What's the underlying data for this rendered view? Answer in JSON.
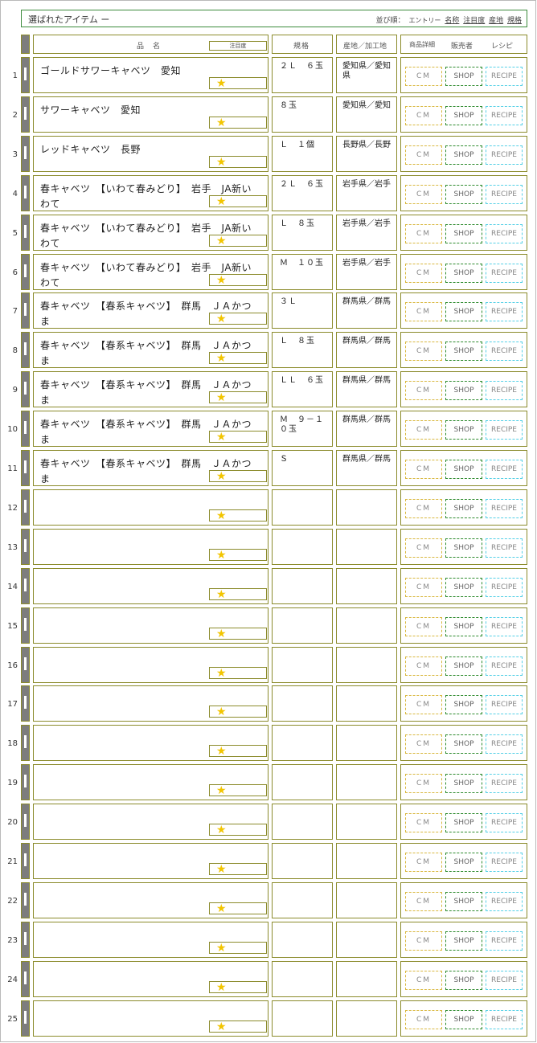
{
  "header": {
    "title": "選ばれたアイテム ー",
    "sort_label": "並び順：",
    "sort_options": [
      "エントリー",
      "名称",
      "注目度",
      "産地",
      "規格"
    ]
  },
  "columns": {
    "name": "品　名",
    "attention": "注目度",
    "spec": "規格",
    "origin": "産地／加工地",
    "detail": "商品詳細",
    "seller": "販売者",
    "recipe": "レシピ"
  },
  "buttons": {
    "cm": "CM",
    "shop": "SHOP",
    "recipe": "RECIPE"
  },
  "star": "★",
  "rows": [
    {
      "num": "1",
      "name": "ゴールドサワーキャベツ　愛知",
      "spec": "２Ｌ　６玉",
      "origin": "愛知県／愛知県"
    },
    {
      "num": "2",
      "name": "サワーキャベツ　愛知",
      "spec": "８玉",
      "origin": "愛知県／愛知"
    },
    {
      "num": "3",
      "name": "レッドキャベツ　長野",
      "spec": "Ｌ　１個",
      "origin": "長野県／長野"
    },
    {
      "num": "4",
      "name": "春キャベツ　【いわて春みどり】　岩手　JA新いわて",
      "spec": "２Ｌ　６玉",
      "origin": "岩手県／岩手"
    },
    {
      "num": "5",
      "name": "春キャベツ　【いわて春みどり】　岩手　JA新いわて",
      "spec": "Ｌ　８玉",
      "origin": "岩手県／岩手"
    },
    {
      "num": "6",
      "name": "春キャベツ　【いわて春みどり】　岩手　JA新いわて",
      "spec": "Ｍ　１０玉",
      "origin": "岩手県／岩手"
    },
    {
      "num": "7",
      "name": "春キャベツ　【春系キャベツ】　群馬　ＪＡかつま",
      "spec": "３Ｌ",
      "origin": "群馬県／群馬"
    },
    {
      "num": "8",
      "name": "春キャベツ　【春系キャベツ】　群馬　ＪＡかつま",
      "spec": "Ｌ　８玉",
      "origin": "群馬県／群馬"
    },
    {
      "num": "9",
      "name": "春キャベツ　【春系キャベツ】　群馬　ＪＡかつま",
      "spec": "ＬＬ　６玉",
      "origin": "群馬県／群馬"
    },
    {
      "num": "10",
      "name": "春キャベツ　【春系キャベツ】　群馬　ＪＡかつま",
      "spec": "Ｍ　９－１０玉",
      "origin": "群馬県／群馬"
    },
    {
      "num": "11",
      "name": "春キャベツ　【春系キャベツ】　群馬　ＪＡかつま",
      "spec": "Ｓ",
      "origin": "群馬県／群馬"
    },
    {
      "num": "12",
      "name": "",
      "spec": "",
      "origin": ""
    },
    {
      "num": "13",
      "name": "",
      "spec": "",
      "origin": ""
    },
    {
      "num": "14",
      "name": "",
      "spec": "",
      "origin": ""
    },
    {
      "num": "15",
      "name": "",
      "spec": "",
      "origin": ""
    },
    {
      "num": "16",
      "name": "",
      "spec": "",
      "origin": ""
    },
    {
      "num": "17",
      "name": "",
      "spec": "",
      "origin": ""
    },
    {
      "num": "18",
      "name": "",
      "spec": "",
      "origin": ""
    },
    {
      "num": "19",
      "name": "",
      "spec": "",
      "origin": ""
    },
    {
      "num": "20",
      "name": "",
      "spec": "",
      "origin": ""
    },
    {
      "num": "21",
      "name": "",
      "spec": "",
      "origin": ""
    },
    {
      "num": "22",
      "name": "",
      "spec": "",
      "origin": ""
    },
    {
      "num": "23",
      "name": "",
      "spec": "",
      "origin": ""
    },
    {
      "num": "24",
      "name": "",
      "spec": "",
      "origin": ""
    },
    {
      "num": "25",
      "name": "",
      "spec": "",
      "origin": ""
    }
  ]
}
